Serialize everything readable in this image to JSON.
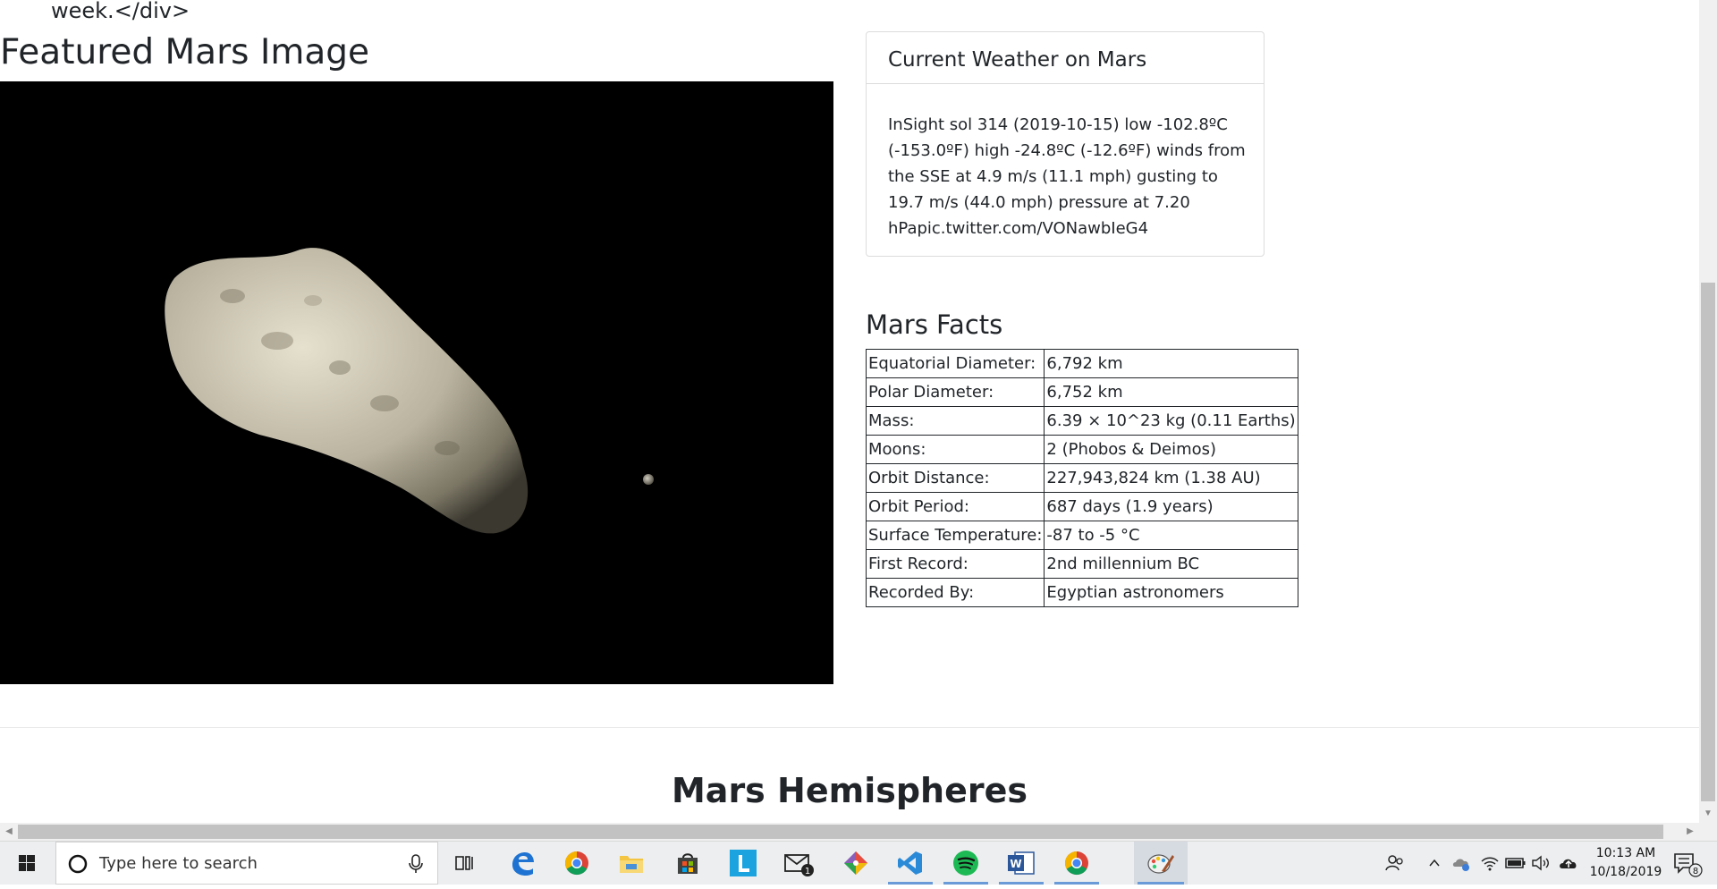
{
  "page": {
    "top_fragment": "week.</div>",
    "featured": {
      "heading": "Featured Mars Image"
    },
    "weather": {
      "title": "Current Weather on Mars",
      "text": "InSight sol 314 (2019-10-15) low -102.8ºC (-153.0ºF) high -24.8ºC (-12.6ºF) winds from the SSE at 4.9 m/s (11.1 mph) gusting to 19.7 m/s (44.0 mph) pressure at 7.20 hPapic.twitter.com/VONawbIeG4"
    },
    "facts": {
      "heading": "Mars Facts",
      "rows": [
        {
          "label": "Equatorial Diameter:",
          "value": "6,792 km"
        },
        {
          "label": "Polar Diameter:",
          "value": "6,752 km"
        },
        {
          "label": "Mass:",
          "value": "6.39 × 10^23 kg (0.11 Earths)"
        },
        {
          "label": "Moons:",
          "value": "2 (Phobos & Deimos)"
        },
        {
          "label": "Orbit Distance:",
          "value": "227,943,824 km (1.38 AU)"
        },
        {
          "label": "Orbit Period:",
          "value": "687 days (1.9 years)"
        },
        {
          "label": "Surface Temperature:",
          "value": "-87 to -5 °C"
        },
        {
          "label": "First Record:",
          "value": "2nd millennium BC"
        },
        {
          "label": "Recorded By:",
          "value": "Egyptian astronomers"
        }
      ]
    },
    "hemispheres": {
      "heading": "Mars Hemispheres"
    }
  },
  "taskbar": {
    "search_placeholder": "Type here to search",
    "apps": [
      {
        "name": "task-view-icon"
      },
      {
        "name": "edge-icon"
      },
      {
        "name": "chrome-icon"
      },
      {
        "name": "file-explorer-icon"
      },
      {
        "name": "store-icon"
      },
      {
        "name": "l-app-icon",
        "label": "L"
      },
      {
        "name": "mail-icon",
        "badge": "1"
      },
      {
        "name": "git-icon"
      },
      {
        "name": "vscode-icon"
      },
      {
        "name": "spotify-icon"
      },
      {
        "name": "word-icon",
        "label": "W"
      },
      {
        "name": "chrome-icon-2"
      },
      {
        "name": "paint-icon"
      }
    ],
    "time": "10:13 AM",
    "date": "10/18/2019",
    "notification_count": "8",
    "colors": {
      "edge": "#1e73d2",
      "vscode": "#2b8ad8",
      "spotify": "#1db954",
      "word": "#2b579a",
      "l_app": "#1aa3df",
      "folder": "#f4c542"
    }
  }
}
